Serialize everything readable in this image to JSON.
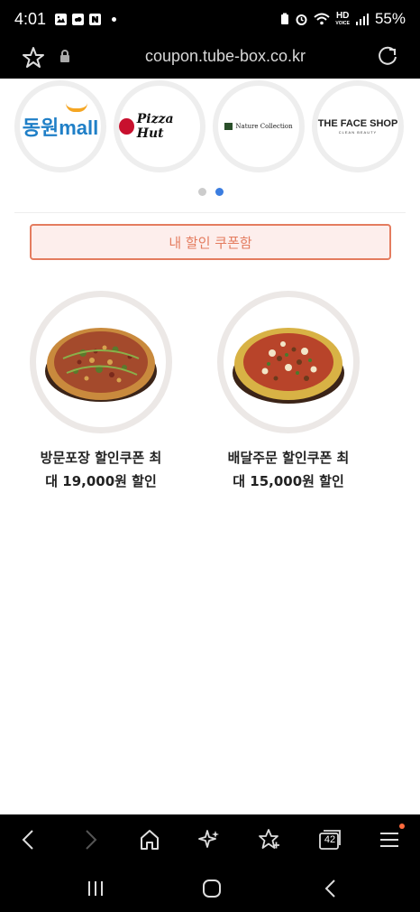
{
  "status_bar": {
    "time": "4:01",
    "left_icons": [
      "gallery-icon",
      "cloud-icon",
      "naver-icon",
      "notification-dot"
    ],
    "right_icons": [
      "battery-saver-icon",
      "alarm-icon",
      "wifi-icon",
      "hd-voice-icon",
      "signal-icon"
    ],
    "hd_label": "HD",
    "voice_label": "VOICE",
    "battery": "55%"
  },
  "browser": {
    "url": "coupon.tube-box.co.kr",
    "tab_count": "42"
  },
  "brands": [
    {
      "name": "동원mall",
      "mall_text": "mall",
      "prefix_text": "동원"
    },
    {
      "name": "Pizza Hut",
      "logo_text": "Pizza Hut"
    },
    {
      "name": "Nature Collection",
      "logo_text": "Nature Collection"
    },
    {
      "name": "THE FACE SHOP",
      "logo_text": "THE FACE SHOP",
      "sub_text": "CLEAN BEAUTY"
    }
  ],
  "pager": {
    "total": 2,
    "active_index": 1
  },
  "coupon_box_button": "내 할인 쿠폰함",
  "products": [
    {
      "title_line1": "방문포장 할인쿠폰 최",
      "title_line2": "대 19,000원 할인"
    },
    {
      "title_line1": "배달주문 할인쿠폰 최",
      "title_line2": "대 15,000원 할인"
    }
  ],
  "colors": {
    "accent": "#e47c5f",
    "accent_bg": "#fdeeec",
    "pager_active": "#3b7de0",
    "pager_inactive": "#cccccc",
    "menu_badge": "#ff6a3d"
  }
}
